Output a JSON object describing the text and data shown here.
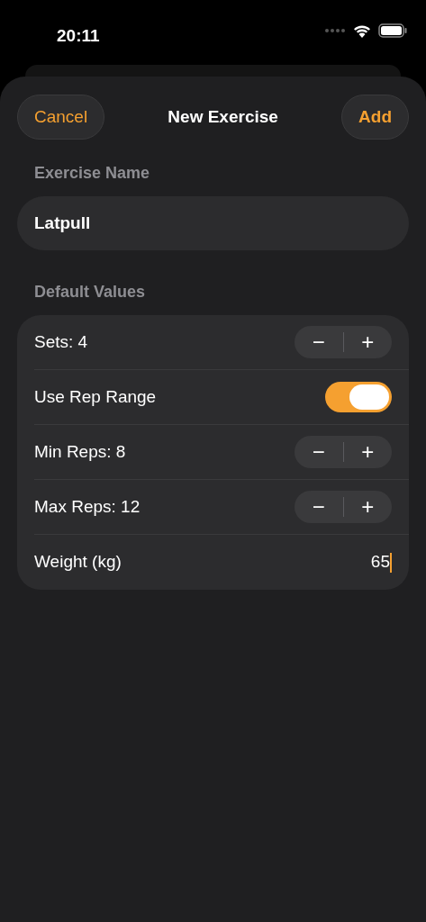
{
  "status_bar": {
    "time": "20:11"
  },
  "nav": {
    "cancel": "Cancel",
    "title": "New Exercise",
    "add": "Add"
  },
  "name_section": {
    "header": "Exercise Name",
    "value": "Latpull"
  },
  "defaults_section": {
    "header": "Default Values",
    "rows": [
      {
        "kind": "stepper",
        "label": "Sets: 4",
        "minus": "−",
        "plus": "+"
      },
      {
        "kind": "toggle",
        "label": "Use Rep Range",
        "on": true
      },
      {
        "kind": "stepper",
        "label": "Min Reps: 8",
        "minus": "−",
        "plus": "+"
      },
      {
        "kind": "stepper",
        "label": "Max Reps: 12",
        "minus": "−",
        "plus": "+"
      },
      {
        "kind": "field",
        "label": "Weight (kg)",
        "value": "65"
      }
    ]
  }
}
